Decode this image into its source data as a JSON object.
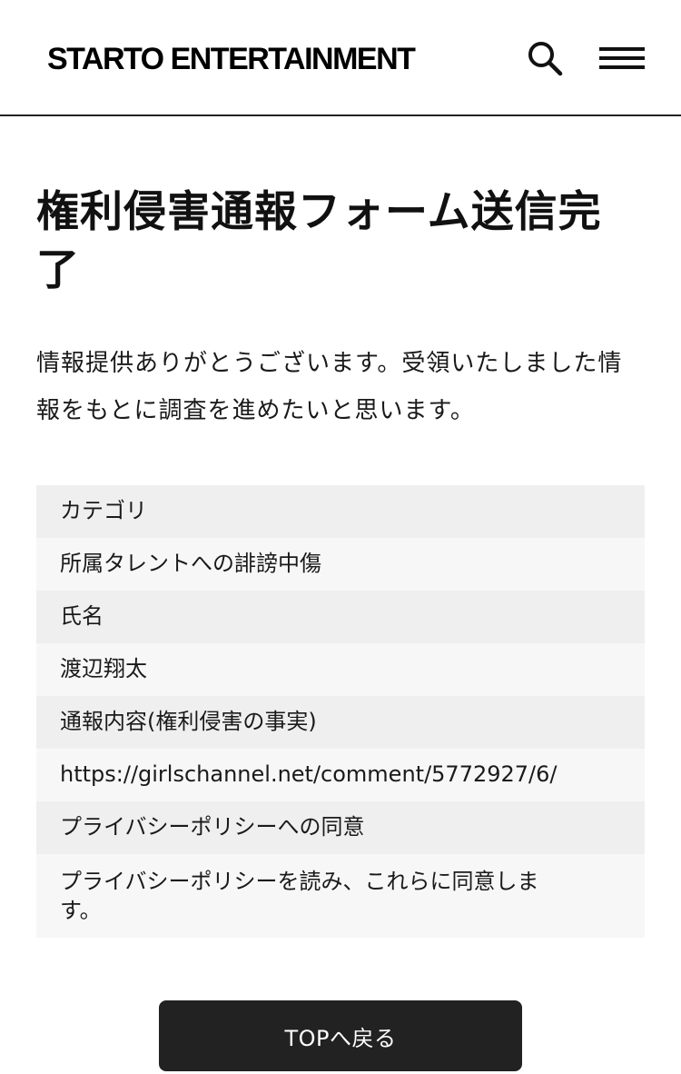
{
  "header": {
    "logo": "STARTO ENTERTAINMENT",
    "search_icon": "search-icon",
    "menu_icon": "hamburger-menu-icon"
  },
  "main": {
    "title": "権利侵害通報フォーム送信完了",
    "lead": "情報提供ありがとうございます。受領いたしました情報をもとに調査を進めたいと思います。",
    "fields": [
      {
        "label": "カテゴリ",
        "value": "所属タレントへの誹謗中傷"
      },
      {
        "label": "氏名",
        "value": "渡辺翔太"
      },
      {
        "label": "通報内容(権利侵害の事実)",
        "value": "https://girlschannel.net/comment/5772927/6/"
      },
      {
        "label": "プライバシーポリシーへの同意",
        "value": "プライバシーポリシーを読み、これらに同意します。"
      }
    ],
    "top_button": "TOPへ戻る"
  },
  "colors": {
    "button_bg": "#222222",
    "label_row_bg": "#efefef",
    "value_row_bg": "#f7f7f7"
  }
}
